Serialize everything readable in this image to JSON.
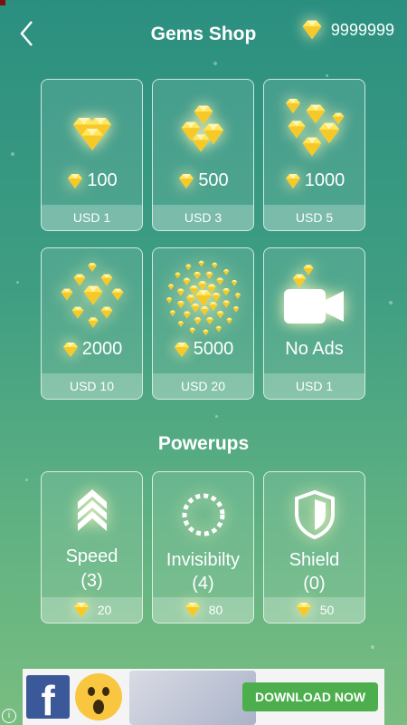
{
  "header": {
    "title": "Gems Shop",
    "balance": "9999999"
  },
  "shop": [
    {
      "amount": "100",
      "price": "USD 1",
      "icon": "gems-small-icon"
    },
    {
      "amount": "500",
      "price": "USD 3",
      "icon": "gems-medium-icon"
    },
    {
      "amount": "1000",
      "price": "USD 5",
      "icon": "gems-large-icon"
    },
    {
      "amount": "2000",
      "price": "USD 10",
      "icon": "gems-cluster-icon"
    },
    {
      "amount": "5000",
      "price": "USD 20",
      "icon": "gems-burst-icon"
    },
    {
      "label": "No Ads",
      "price": "USD 1",
      "icon": "camera-icon"
    }
  ],
  "powerups_title": "Powerups",
  "powerups": [
    {
      "name": "Speed",
      "count": "(3)",
      "cost": "20",
      "icon": "chevrons-up-icon"
    },
    {
      "name": "Invisibilty",
      "count": "(4)",
      "cost": "80",
      "icon": "dashed-circle-icon"
    },
    {
      "name": "Shield",
      "count": "(0)",
      "cost": "50",
      "icon": "shield-icon"
    }
  ],
  "ad": {
    "button": "DOWNLOAD NOW",
    "brand": "f",
    "info": "i"
  },
  "colors": {
    "gem": "#ffe45c",
    "background_top": "#2b8f80",
    "background_bottom": "#79bd80"
  }
}
